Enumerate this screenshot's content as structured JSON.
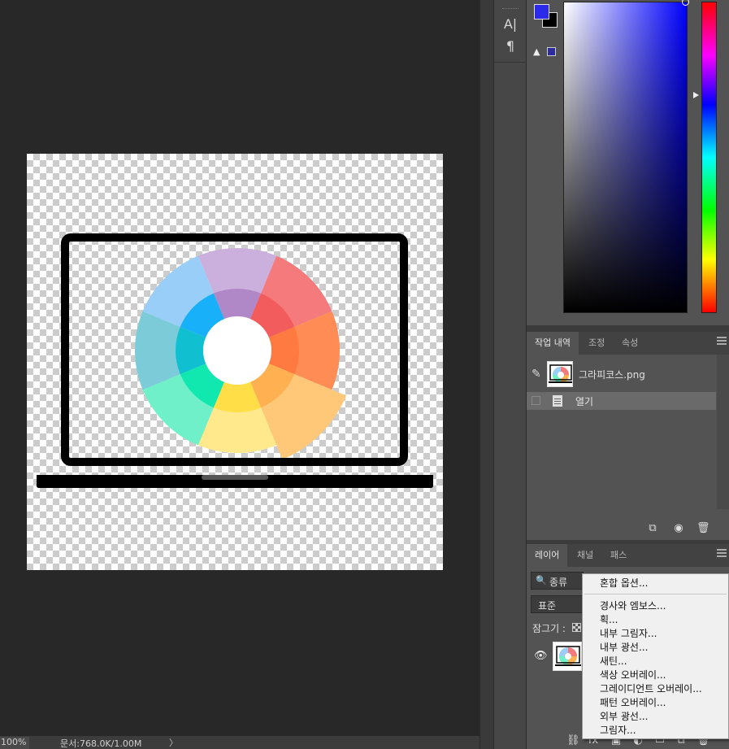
{
  "status_bar": {
    "zoom": "100%",
    "doc_info": "문서:768.0K/1.00M",
    "arrow": "〉"
  },
  "tools": {
    "type_tool": "A|",
    "paragraph_tool": "¶"
  },
  "color_panel": {
    "foreground": "#2a2ae8",
    "background": "#000000",
    "gamut_warning": "▲"
  },
  "history_panel": {
    "tabs": [
      "작업 내역",
      "조정",
      "속성"
    ],
    "snapshot_label": "그라피코스.png",
    "steps": [
      "열기"
    ]
  },
  "layers_panel": {
    "tabs": [
      "레이어",
      "채널",
      "패스"
    ],
    "kind_filter": "종류",
    "blend_mode": "표준",
    "lock_label": "잠그기 :"
  },
  "context_menu": {
    "items": [
      "혼합 옵션...",
      "경사와 엠보스...",
      "획...",
      "내부 그림자...",
      "내부 광선...",
      "새틴...",
      "색상 오버레이...",
      "그레이디언트 오버레이...",
      "패턴 오버레이...",
      "외부 광선...",
      "그림자..."
    ]
  },
  "canvas": {
    "wheel_colors": [
      "#cbb0dd",
      "#f47a7c",
      "#ff8c54",
      "#ffc878",
      "#ffe98c",
      "#6ff0c8",
      "#7ccbd8",
      "#99cef8"
    ],
    "wheel_inner_colors": [
      "#b088c8",
      "#f25c5c",
      "#ff7a40",
      "#ffb050",
      "#ffde48",
      "#10e8b0",
      "#10c0d0",
      "#18b0f8"
    ]
  }
}
